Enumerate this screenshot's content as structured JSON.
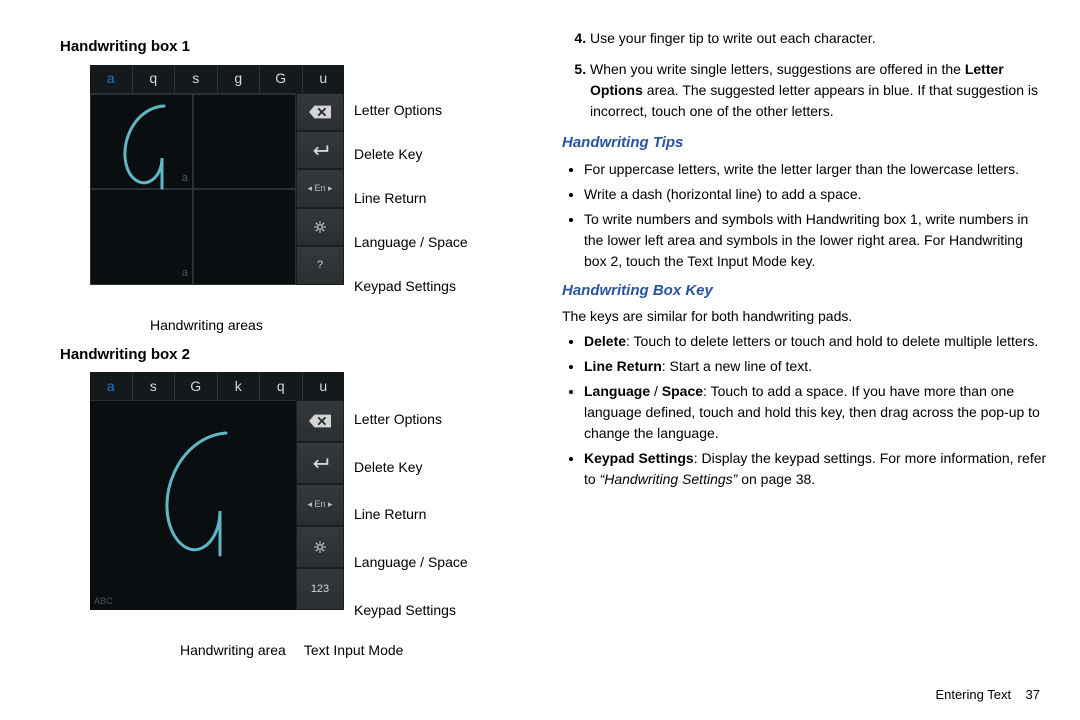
{
  "left": {
    "title1": "Handwriting box 1",
    "title2": "Handwriting box 2",
    "shot1": {
      "suggestions": [
        "a",
        "q",
        "s",
        "g",
        "G",
        "u"
      ],
      "highlight_index": 0,
      "quad_labels": [
        "a",
        "",
        "a",
        ""
      ],
      "mode_corner": "",
      "keys_last_label": "",
      "keys_last_icon": "gear"
    },
    "shot2": {
      "suggestions": [
        "a",
        "s",
        "G",
        "k",
        "q",
        "u"
      ],
      "highlight_index": 0,
      "mode_corner": "ABC",
      "keys_last_label": "123",
      "keys_last_icon": ""
    },
    "key_callouts": [
      "Letter Options",
      "Delete Key",
      "Line Return",
      "Language / Space",
      "Keypad Settings"
    ],
    "under1": "Handwriting areas",
    "under2_a": "Handwriting area",
    "under2_b": "Text Input Mode",
    "lang_key_label": "En"
  },
  "right": {
    "steps": [
      {
        "n": "4.",
        "text": "Use your finger tip to write out each character."
      },
      {
        "n": "5.",
        "text": "When you write single letters, suggestions are offered in the ",
        "bold1": "Letter Options",
        "text2": " area. The suggested letter appears in blue. If that suggestion is incorrect, touch one of the other letters."
      }
    ],
    "tips_head": "Handwriting Tips",
    "tips": [
      "For uppercase letters, write the letter larger than the lowercase letters.",
      "Write a dash (horizontal line) to add a space.",
      "To write numbers and symbols with Handwriting box 1, write numbers in the lower left area and symbols in the lower right area. For Handwriting box 2, touch the Text Input Mode key."
    ],
    "keyhead": "Handwriting Box Key",
    "key_intro": "The keys are similar for both handwriting pads.",
    "key_items": [
      {
        "b": "Delete",
        "t": ": Touch to delete letters or touch and hold to delete multiple letters."
      },
      {
        "b": "Line Return",
        "t": ": Start a new line of text."
      },
      {
        "b": "Language",
        "mid": " / ",
        "b2": "Space",
        "t": ": Touch to add a space. If you have more than one language defined, touch and hold this key, then drag across the pop-up to change the language."
      },
      {
        "b": "Keypad Settings",
        "t": ": Display the keypad settings. For more information, refer to ",
        "i": "“Handwriting Settings”",
        "t2": "  on page 38."
      }
    ]
  },
  "foot": {
    "section": "Entering Text",
    "page": "37"
  }
}
